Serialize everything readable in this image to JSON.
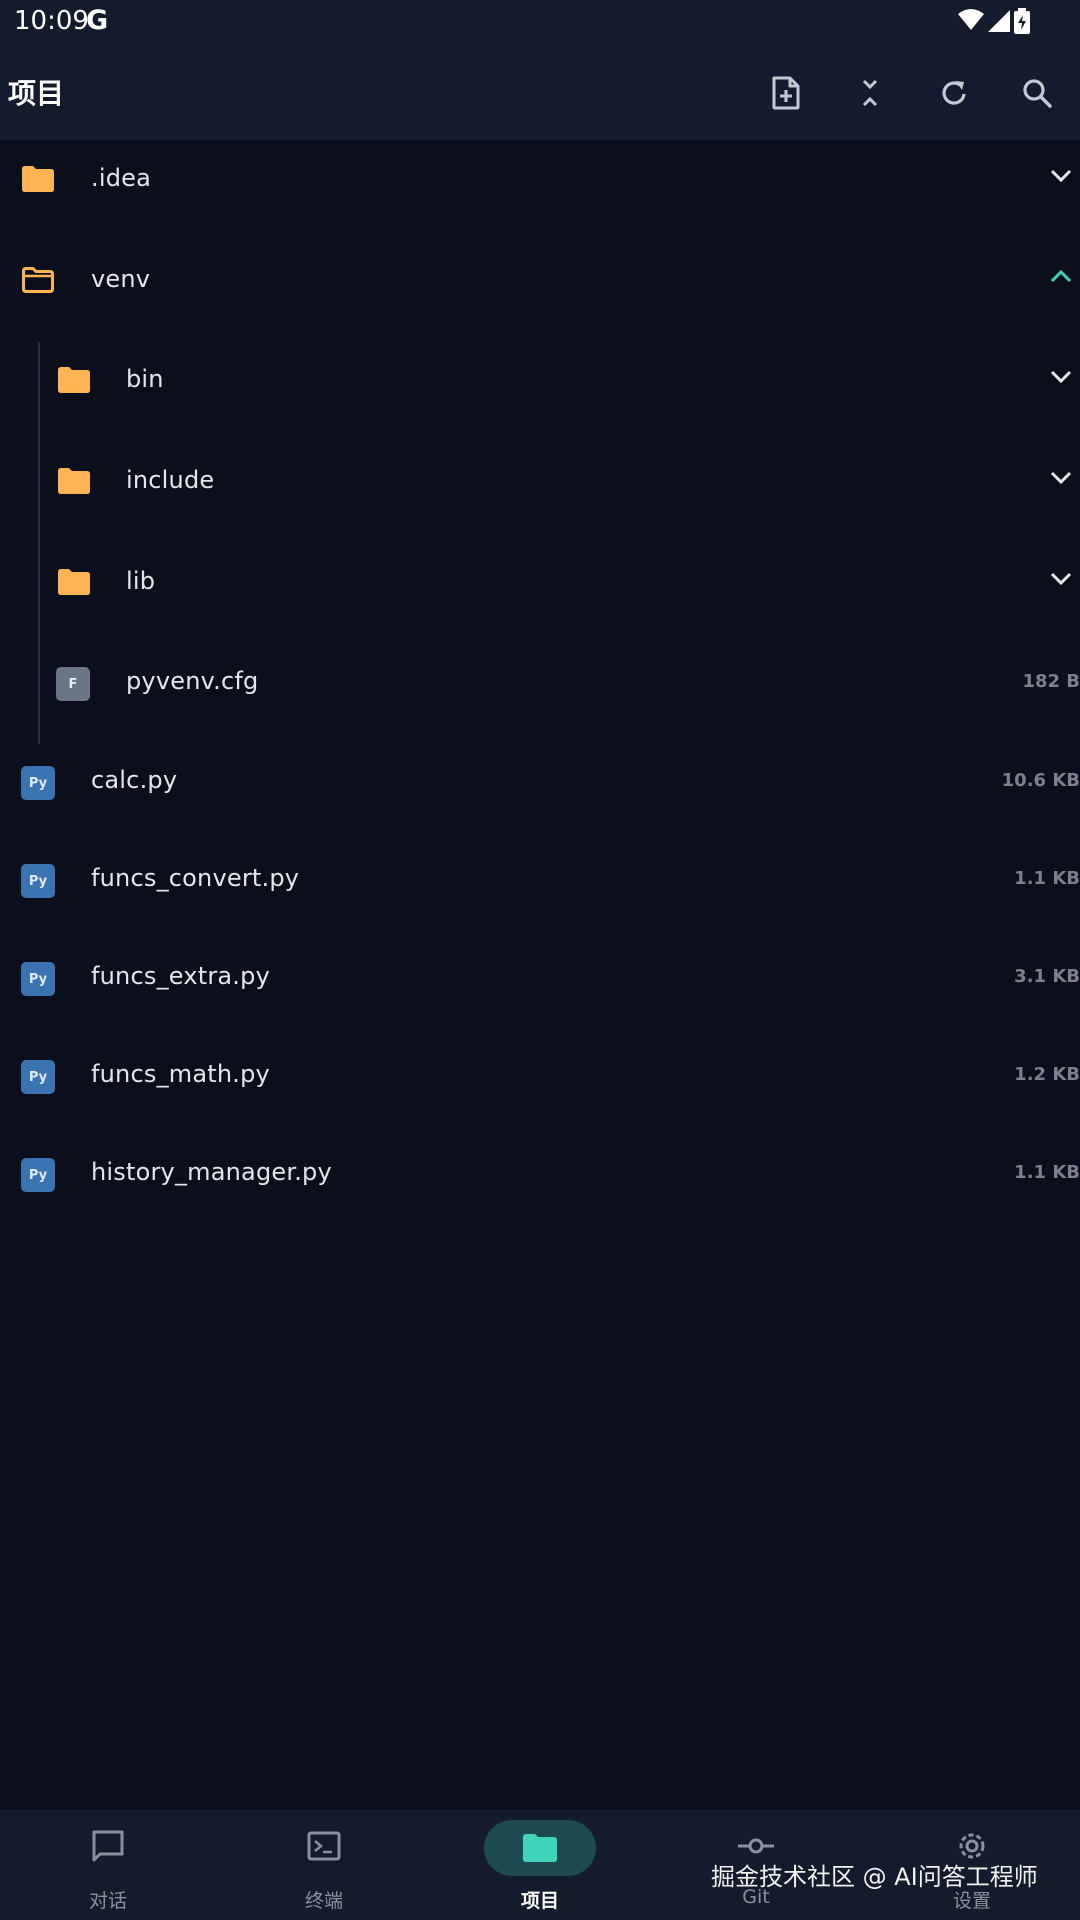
{
  "status_bar": {
    "time": "10:09",
    "google_glyph": "G",
    "icons": [
      "wifi-icon",
      "signal-icon",
      "battery-charging-icon"
    ]
  },
  "app_bar": {
    "title": "项目",
    "actions": [
      "new-file-icon",
      "collapse-all-icon",
      "refresh-icon",
      "search-icon"
    ]
  },
  "tree": {
    "items": [
      {
        "name": ".idea",
        "type": "folder",
        "state": "collapsed"
      },
      {
        "name": "venv",
        "type": "folder",
        "state": "expanded"
      },
      {
        "name": "bin",
        "type": "folder",
        "state": "collapsed"
      },
      {
        "name": "include",
        "type": "folder",
        "state": "collapsed"
      },
      {
        "name": "lib",
        "type": "folder",
        "state": "collapsed"
      },
      {
        "name": "pyvenv.cfg",
        "type": "file",
        "badge": "F",
        "size": "182 B"
      },
      {
        "name": "calc.py",
        "type": "python",
        "badge": "Py",
        "size": "10.6 KB"
      },
      {
        "name": "funcs_convert.py",
        "type": "python",
        "badge": "Py",
        "size": "1.1 KB"
      },
      {
        "name": "funcs_extra.py",
        "type": "python",
        "badge": "Py",
        "size": "3.1 KB"
      },
      {
        "name": "funcs_math.py",
        "type": "python",
        "badge": "Py",
        "size": "1.2 KB"
      },
      {
        "name": "history_manager.py",
        "type": "python",
        "badge": "Py",
        "size": "1.1 KB"
      }
    ]
  },
  "bottom_nav": {
    "items": [
      {
        "label": "对话",
        "icon": "chat-icon"
      },
      {
        "label": "终端",
        "icon": "terminal-icon"
      },
      {
        "label": "项目",
        "icon": "folder-icon",
        "active": true
      },
      {
        "label": "Git",
        "icon": "git-commit-icon"
      },
      {
        "label": "设置",
        "icon": "settings-icon"
      }
    ]
  },
  "watermark": "掘金技术社区 @ AI问答工程师",
  "colors": {
    "background": "#0b0f1b",
    "bar": "#131b2c",
    "folder": "#ffb454",
    "accent": "#3fd3b8",
    "python_badge": "#3a73b0"
  }
}
